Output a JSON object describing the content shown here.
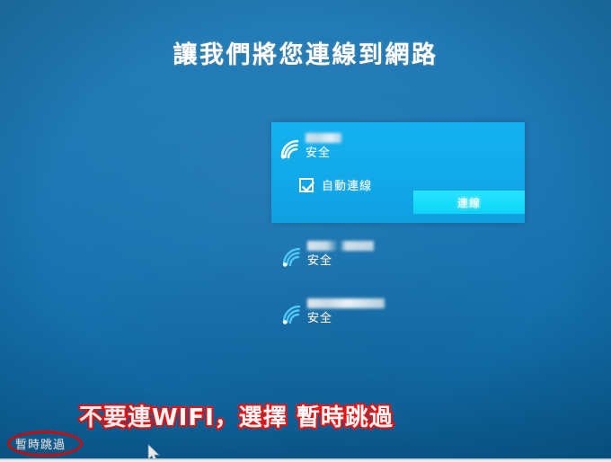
{
  "page": {
    "title": "讓我們將您連線到網路",
    "background_color": "#1571b0",
    "panel_color": "#11a8e8",
    "accent_color": "#16dcfb",
    "annotation_color": "#ee1111"
  },
  "networks": {
    "selected": {
      "ssid": "",
      "ssid_hidden": true,
      "security_label": "安全",
      "icon": "wifi-icon",
      "auto_connect": {
        "label": "自動連線",
        "checked": true
      },
      "connect_button_label": "連線"
    },
    "others": [
      {
        "ssid": "",
        "ssid_hidden": true,
        "security_label": "安全",
        "icon": "wifi-icon"
      },
      {
        "ssid": "",
        "ssid_hidden": true,
        "security_label": "安全",
        "icon": "wifi-icon"
      }
    ]
  },
  "footer": {
    "skip_label": "暫時跳過"
  },
  "annotation": {
    "note": "不要連WIFI，選擇  暫時跳過",
    "circle_target": "暫時跳過"
  },
  "cursor": {
    "icon": "mouse-pointer-icon"
  }
}
